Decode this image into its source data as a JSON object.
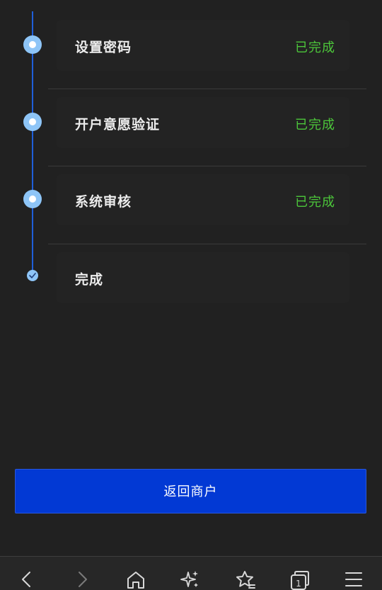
{
  "steps": [
    {
      "title": "设置密码",
      "status": "已完成"
    },
    {
      "title": "开户意愿验证",
      "status": "已完成"
    },
    {
      "title": "系统审核",
      "status": "已完成"
    },
    {
      "title": "完成",
      "status": ""
    }
  ],
  "return_button": {
    "label": "返回商户"
  },
  "bottom_nav": {
    "items": [
      "back-icon",
      "forward-icon",
      "home-icon",
      "sparkle-icon",
      "star-icon",
      "tabs-icon",
      "menu-icon"
    ],
    "tab_count": "1"
  },
  "colors": {
    "accent_blue": "#0239d4",
    "timeline_line": "#1f5fd9",
    "dot_fill": "#8ec5f7",
    "status_green": "#4cc63a",
    "background": "#212121"
  }
}
